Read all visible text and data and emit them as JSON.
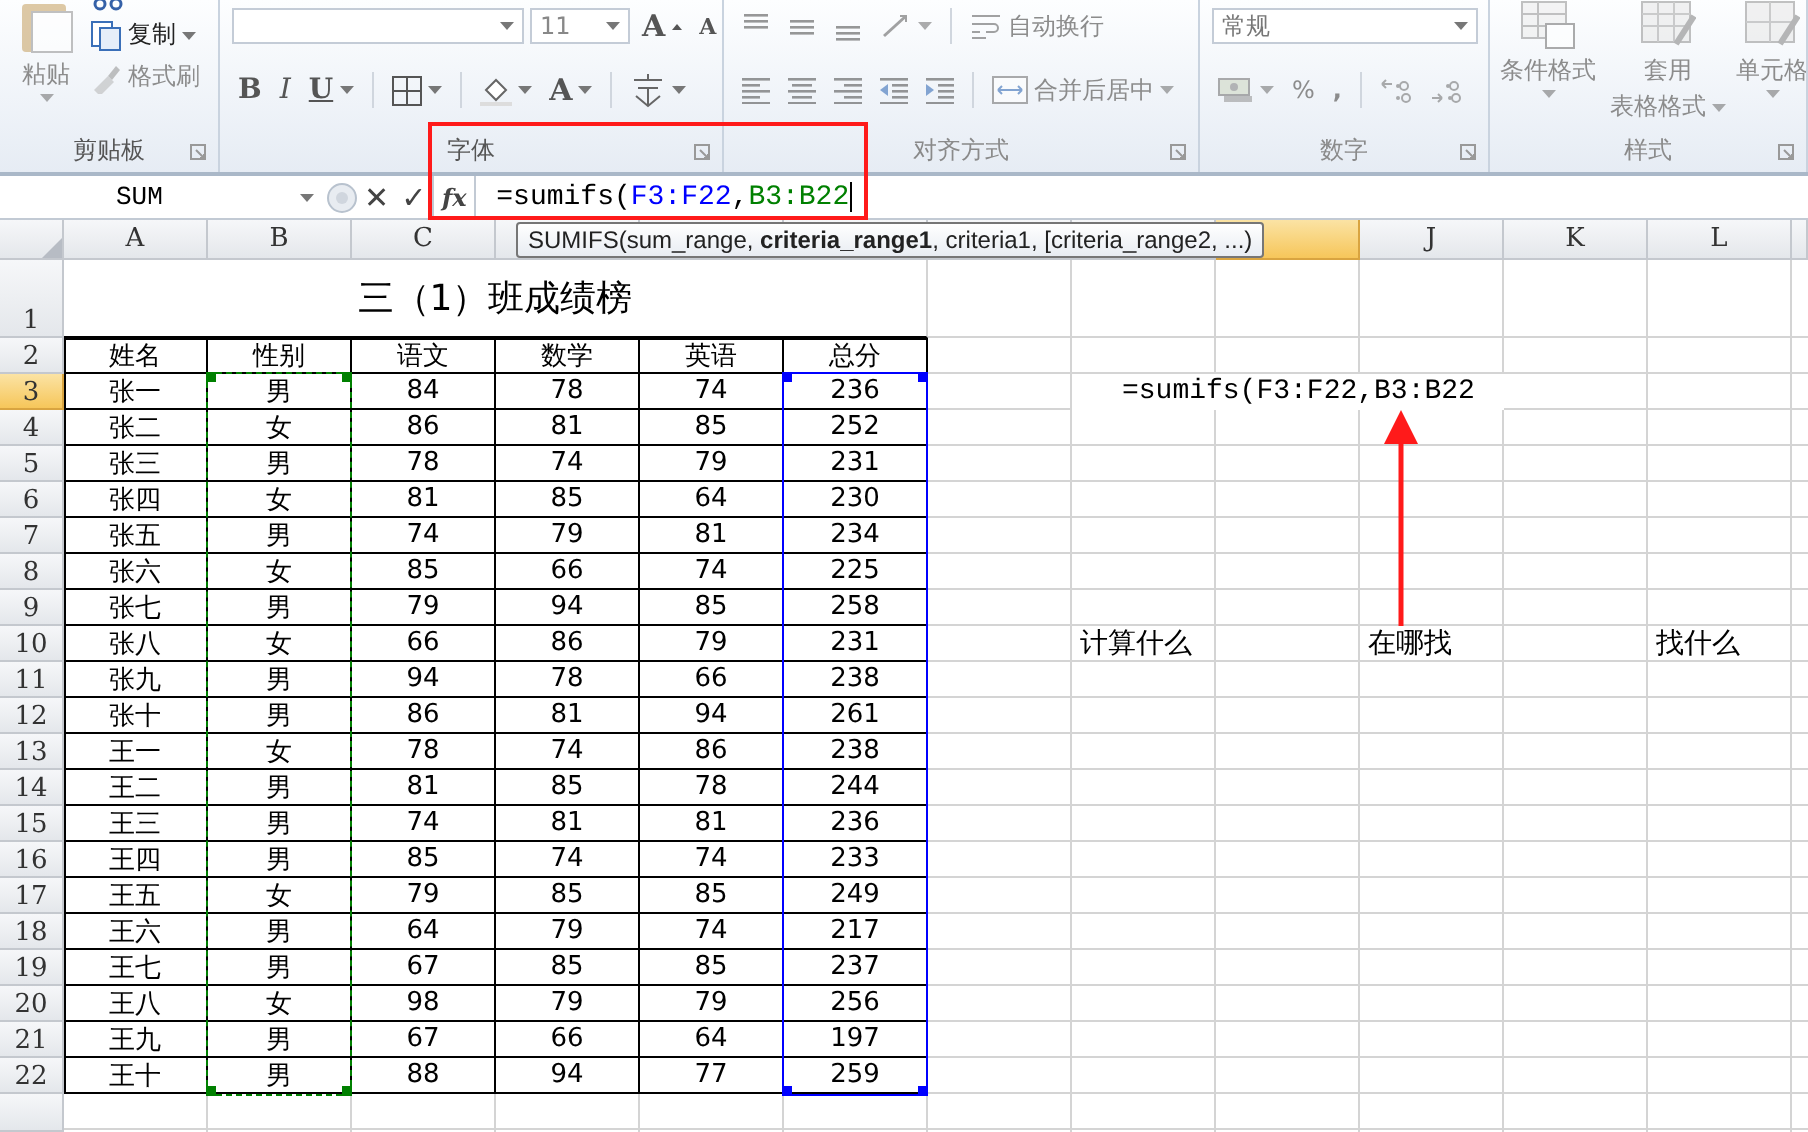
{
  "ribbon": {
    "groups": [
      {
        "kind": "clipboard",
        "label": "剪贴板",
        "items": [
          {
            "text": "粘贴",
            "disabled": true
          },
          {
            "text": "复制",
            "disabled": false
          },
          {
            "text": "格式刷",
            "disabled": true
          }
        ]
      },
      {
        "kind": "font",
        "label": "字体",
        "size": "11",
        "grow": "A",
        "shrink": "A",
        "bold": "B",
        "italic": "I",
        "underline": "U",
        "font_color": "A"
      },
      {
        "kind": "alignment",
        "label": "对齐方式",
        "wrap_text": "自动换行",
        "merge_center": "合并后居中",
        "disabled": true
      },
      {
        "kind": "number",
        "label": "数字",
        "format": "常规",
        "percent": "%",
        "comma": ",",
        "disabled": true
      },
      {
        "kind": "styles",
        "label": "样式",
        "items": [
          {
            "lines": [
              "条件格式"
            ]
          },
          {
            "lines": [
              "套用",
              "表格格式"
            ]
          },
          {
            "lines": [
              "单元格"
            ]
          }
        ],
        "disabled": true
      }
    ]
  },
  "formula_bar": {
    "name_box": "SUM",
    "cancel": "✕",
    "enter": "✓",
    "function": "fx",
    "formula": [
      {
        "kind": "plain",
        "text": "=sumifs("
      },
      {
        "kind": "reference",
        "text": "F3:F22",
        "color": "#0000ff"
      },
      {
        "kind": "plain",
        "text": ","
      },
      {
        "kind": "reference",
        "text": "B3:B22",
        "color": "#008000"
      }
    ]
  },
  "sheet": {
    "columns": [
      {
        "letter": "A",
        "selected": false
      },
      {
        "letter": "B",
        "selected": false
      },
      {
        "letter": "C",
        "selected": false
      },
      {
        "selected": false
      },
      {
        "selected": false
      },
      {
        "selected": false
      },
      {
        "selected": false
      },
      {
        "selected": false
      },
      {
        "selected": true
      },
      {
        "letter": "J",
        "selected": false
      },
      {
        "letter": "K",
        "selected": false
      },
      {
        "letter": "L",
        "selected": false
      }
    ],
    "rows": [
      {
        "number": "1",
        "selected": false
      },
      {
        "number": "2",
        "selected": false
      },
      {
        "number": "3",
        "selected": true
      },
      {
        "number": "4",
        "selected": false
      },
      {
        "number": "5",
        "selected": false
      },
      {
        "number": "6",
        "selected": false
      },
      {
        "number": "7",
        "selected": false
      },
      {
        "number": "8",
        "selected": false
      },
      {
        "number": "9",
        "selected": false
      },
      {
        "number": "10",
        "selected": false
      },
      {
        "number": "11",
        "selected": false
      },
      {
        "number": "12",
        "selected": false
      },
      {
        "number": "13",
        "selected": false
      },
      {
        "number": "14",
        "selected": false
      },
      {
        "number": "15",
        "selected": false
      },
      {
        "number": "16",
        "selected": false
      },
      {
        "number": "17",
        "selected": false
      },
      {
        "number": "18",
        "selected": false
      },
      {
        "number": "19",
        "selected": false
      },
      {
        "number": "20",
        "selected": false
      },
      {
        "number": "21",
        "selected": false
      },
      {
        "number": "22",
        "selected": false
      }
    ],
    "table": {
      "title": "三（1）班成绩榜",
      "header": [
        "姓名",
        "性别",
        "语文",
        "数学",
        "英语",
        "总分"
      ],
      "data": [
        [
          "张一",
          "男",
          "84",
          "78",
          "74",
          "236"
        ],
        [
          "张二",
          "女",
          "86",
          "81",
          "85",
          "252"
        ],
        [
          "张三",
          "男",
          "78",
          "74",
          "79",
          "231"
        ],
        [
          "张四",
          "女",
          "81",
          "85",
          "64",
          "230"
        ],
        [
          "张五",
          "男",
          "74",
          "79",
          "81",
          "234"
        ],
        [
          "张六",
          "女",
          "85",
          "66",
          "74",
          "225"
        ],
        [
          "张七",
          "男",
          "79",
          "94",
          "85",
          "258"
        ],
        [
          "张八",
          "女",
          "66",
          "86",
          "79",
          "231"
        ],
        [
          "张九",
          "男",
          "94",
          "78",
          "66",
          "238"
        ],
        [
          "张十",
          "男",
          "86",
          "81",
          "94",
          "261"
        ],
        [
          "王一",
          "女",
          "78",
          "74",
          "86",
          "238"
        ],
        [
          "王二",
          "男",
          "81",
          "85",
          "78",
          "244"
        ],
        [
          "王三",
          "男",
          "74",
          "81",
          "81",
          "236"
        ],
        [
          "王四",
          "男",
          "85",
          "74",
          "74",
          "233"
        ],
        [
          "王五",
          "女",
          "79",
          "85",
          "85",
          "249"
        ],
        [
          "王六",
          "男",
          "64",
          "79",
          "74",
          "217"
        ],
        [
          "王七",
          "男",
          "67",
          "85",
          "85",
          "237"
        ],
        [
          "王八",
          "女",
          "98",
          "79",
          "79",
          "256"
        ],
        [
          "王九",
          "男",
          "67",
          "66",
          "64",
          "197"
        ],
        [
          "王十",
          "男",
          "88",
          "94",
          "77",
          "259"
        ]
      ]
    },
    "reference_ranges": [
      {
        "color": "#0000ff"
      },
      {
        "color": "#008000"
      }
    ],
    "cell_editor": "=sumifs(F3:F22,B3:B22",
    "notes": [
      "计算什么",
      "在哪找",
      "找什么"
    ],
    "function_tooltip": "SUMIFS(sum_range, **criteria_range1**, criteria1, [criteria_range2, ...)"
  }
}
